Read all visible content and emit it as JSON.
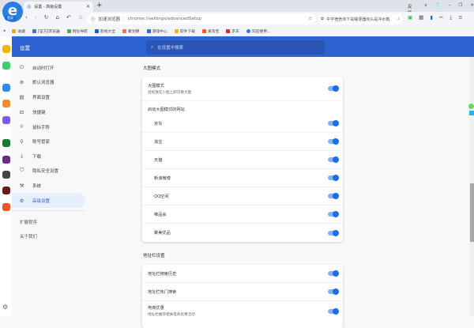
{
  "tab": {
    "title": "设置 - 高级设置",
    "new_tab": "+"
  },
  "window": {
    "account": "反馈",
    "min": "–",
    "restore": "❐",
    "close": "✕"
  },
  "logo": {
    "badge": "登录"
  },
  "address": {
    "site_label": "加速浏览器",
    "url": "chrome://settings/advancedSetup"
  },
  "search_box": {
    "text": "中字宿舍床下是睡便器床头是冲水箱"
  },
  "bookmarks": [
    "收藏",
    "[官方]浏览器",
    "网址导航",
    "影视大全",
    "聚划算",
    "游戏中心",
    "软件下载",
    "爱淘宝",
    "京东",
    "欢迎使用..."
  ],
  "header": {
    "title": "设置",
    "search_placeholder": "在设置中搜索"
  },
  "sidebar": {
    "items": [
      {
        "label": "启动时打开",
        "icon": "power-icon"
      },
      {
        "label": "默认浏览器",
        "icon": "globe-icon"
      },
      {
        "label": "界面设置",
        "icon": "window-icon"
      },
      {
        "label": "快捷键",
        "icon": "keyboard-icon"
      },
      {
        "label": "鼠标手势",
        "icon": "mouse-icon"
      },
      {
        "label": "账号管家",
        "icon": "key-icon"
      },
      {
        "label": "下载",
        "icon": "download-icon"
      },
      {
        "label": "隐私安全设置",
        "icon": "shield-icon"
      },
      {
        "label": "系统",
        "icon": "wrench-icon"
      },
      {
        "label": "高级设置",
        "icon": "gear-icon",
        "active": true
      }
    ],
    "extensions": "扩展程序",
    "about": "关于我们"
  },
  "big_image": {
    "section": "大图模式",
    "title": "大图模式",
    "desc": "鼠标放在小图上即可看大图",
    "sites_label": "启动大图模式的网站",
    "sites": [
      "京东",
      "淘宝",
      "天猫",
      "新浪微博",
      "QQ空间",
      "唯品会",
      "聚美优品"
    ]
  },
  "address_bar": {
    "section": "地址栏设置",
    "items": [
      "地址栏搜索历史",
      "地址栏热门搜索"
    ],
    "ecommerce_title": "电商优惠",
    "ecommerce_desc": "地址栏推荐相关电商优惠活动"
  },
  "colors": {
    "accent": "#2f63d1",
    "toggle": "#1a6ee8"
  }
}
